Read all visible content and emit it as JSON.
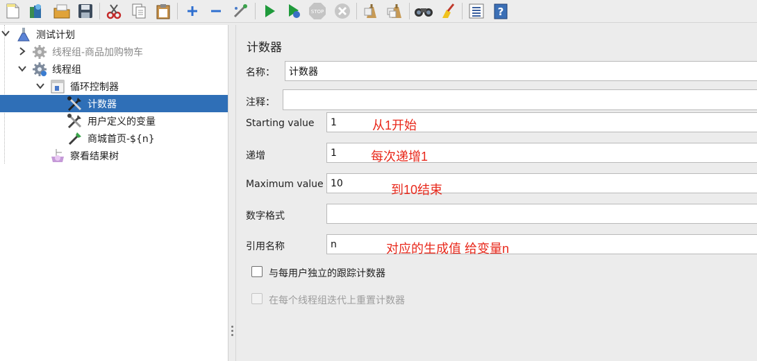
{
  "toolbar": {
    "icons": [
      "new-icon",
      "templates-icon",
      "open-icon",
      "save-icon",
      "cut-icon",
      "copy-icon",
      "paste-icon",
      "expand-icon",
      "collapse-icon",
      "toggle-icon",
      "start-icon",
      "start-no-pause-icon",
      "stop-icon",
      "shutdown-icon",
      "clear-icon",
      "clear-all-icon",
      "search-icon",
      "reset-search-icon",
      "function-helper-icon",
      "help-icon"
    ]
  },
  "tree": {
    "items": [
      {
        "label": "测试计划"
      },
      {
        "label": "线程组-商品加购物车"
      },
      {
        "label": "线程组"
      },
      {
        "label": "循环控制器"
      },
      {
        "label": "计数器"
      },
      {
        "label": "用户定义的变量"
      },
      {
        "label": "商城首页-${n}"
      },
      {
        "label": "察看结果树"
      }
    ]
  },
  "form": {
    "title": "计数器",
    "name_label": "名称：",
    "name_value": "计数器",
    "comment_label": "注释：",
    "comment_value": "",
    "start_label": "Starting value",
    "start_value": "1",
    "incr_label": "递增",
    "incr_value": "1",
    "max_label": "Maximum value",
    "max_value": "10",
    "format_label": "数字格式",
    "format_value": "",
    "ref_label": "引用名称",
    "ref_value": "n",
    "per_user_label": "与每用户独立的跟踪计数器",
    "reset_label": "在每个线程组迭代上重置计数器"
  },
  "annotations": {
    "start": "从1开始",
    "incr": "每次递增1",
    "max": "到10结束",
    "ref": "对应的生成值 给变量n"
  }
}
